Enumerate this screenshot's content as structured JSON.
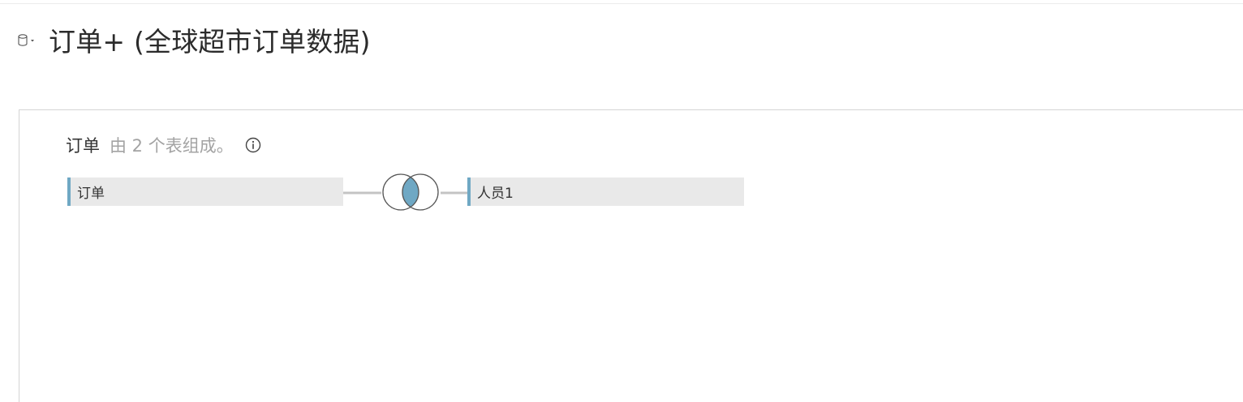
{
  "datasource": {
    "title": "订单+ (全球超市订单数据)",
    "icon": "database-icon"
  },
  "logical_table": {
    "name": "订单",
    "description": "由 2 个表组成。",
    "info_icon": "info-icon"
  },
  "physical_tables": {
    "left": {
      "label": "订单"
    },
    "right": {
      "label": "人员1"
    }
  },
  "join": {
    "type": "inner",
    "icon": "inner-join-icon"
  },
  "colors": {
    "table_accent": "#6fa8c4",
    "table_background": "#e9e9e9",
    "join_fill": "#6fa8c4",
    "description_text": "#a3a3a3"
  }
}
